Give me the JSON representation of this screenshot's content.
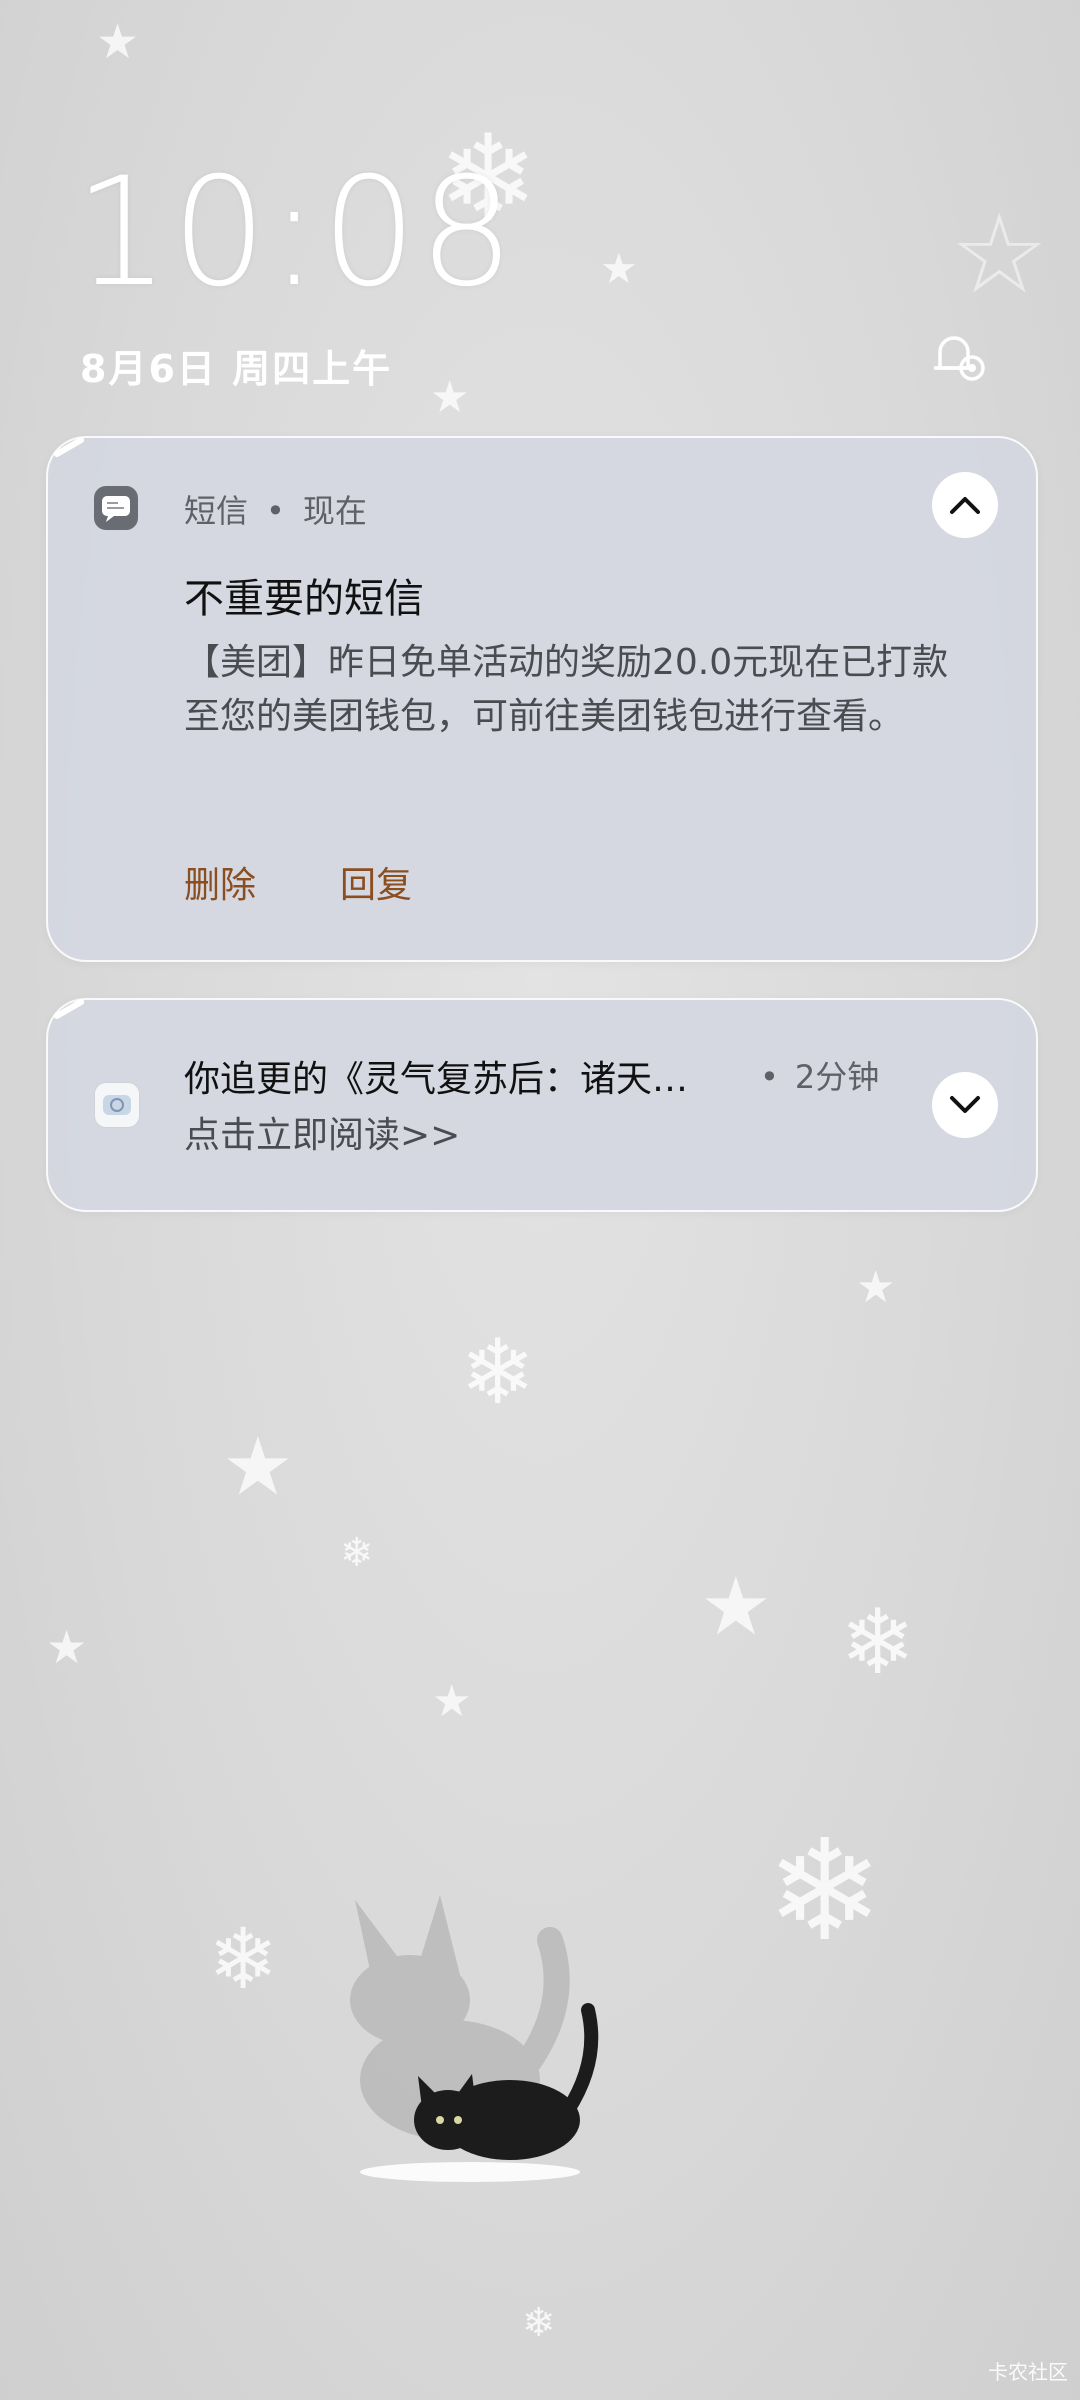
{
  "lockscreen": {
    "time": "10:08",
    "date": "8月6日 周四上午"
  },
  "notifications": [
    {
      "app_name": "短信",
      "time": "现在",
      "title": "不重要的短信",
      "body": "【美团】昨日免单活动的奖励20.0元现在已打款至您的美团钱包，可前往美团钱包进行查看。",
      "actions": [
        "删除",
        "回复"
      ],
      "icon": "message-icon",
      "expanded": true
    },
    {
      "title": "你追更的《灵气复苏后：诸天…",
      "time": "2分钟",
      "body": "点击立即阅读>>",
      "icon": "reader-app-icon",
      "expanded": false
    }
  ],
  "dot_separator": "•",
  "watermark": "卡农社区",
  "colors": {
    "action": "#8a4e21",
    "card_bg": "#d4d7e0",
    "clock": "#ffffff"
  }
}
